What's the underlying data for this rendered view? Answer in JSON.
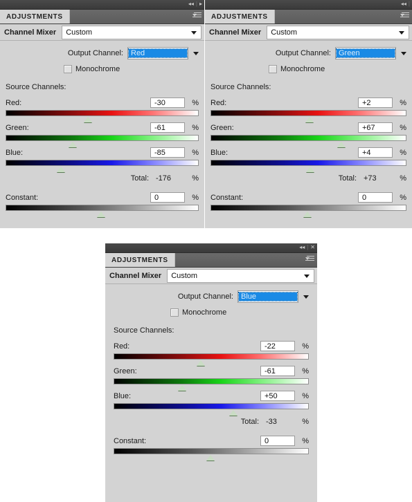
{
  "panels": [
    {
      "id": "panel-red",
      "titlebar": {
        "collapse_icon": "◂◂",
        "separator": "|",
        "expand_icon": "▸"
      },
      "tab_label": "ADJUSTMENTS",
      "menu_icon": "panel-menu-icon",
      "preset_label": "Channel Mixer",
      "preset_value": "Custom",
      "output_channel_label": "Output Channel:",
      "output_channel_value": "Red",
      "monochrome_label": "Monochrome",
      "monochrome_checked": false,
      "source_channels_label": "Source Channels:",
      "channels": [
        {
          "name": "Red:",
          "value": "-30",
          "unit": "%",
          "slider_pos": 42.5,
          "tint": "red"
        },
        {
          "name": "Green:",
          "value": "-61",
          "unit": "%",
          "slider_pos": 34.7,
          "tint": "green"
        },
        {
          "name": "Blue:",
          "value": "-85",
          "unit": "%",
          "slider_pos": 28.7,
          "tint": "blue"
        }
      ],
      "total_label": "Total:",
      "total_value": "-176",
      "total_unit": "%",
      "constant_label": "Constant:",
      "constant_value": "0",
      "constant_unit": "%",
      "constant_pos": 49.5
    },
    {
      "id": "panel-green",
      "titlebar": {
        "collapse_icon": "◂◂",
        "separator": "|",
        "expand_icon": ""
      },
      "tab_label": "ADJUSTMENTS",
      "menu_icon": "panel-menu-icon",
      "preset_label": "Channel Mixer",
      "preset_value": "Custom",
      "output_channel_label": "Output Channel:",
      "output_channel_value": "Green",
      "monochrome_label": "Monochrome",
      "monochrome_checked": false,
      "source_channels_label": "Source Channels:",
      "channels": [
        {
          "name": "Red:",
          "value": "+2",
          "unit": "%",
          "slider_pos": 50.5,
          "tint": "red"
        },
        {
          "name": "Green:",
          "value": "+67",
          "unit": "%",
          "slider_pos": 67.0,
          "tint": "green"
        },
        {
          "name": "Blue:",
          "value": "+4",
          "unit": "%",
          "slider_pos": 51.0,
          "tint": "blue"
        }
      ],
      "total_label": "Total:",
      "total_value": "+73",
      "total_unit": "%",
      "constant_label": "Constant:",
      "constant_value": "0",
      "constant_unit": "%",
      "constant_pos": 49.5
    },
    {
      "id": "panel-blue",
      "titlebar": {
        "collapse_icon": "◂◂",
        "separator": "|",
        "expand_icon": "✕"
      },
      "tab_label": "ADJUSTMENTS",
      "menu_icon": "panel-menu-icon",
      "preset_label": "Channel Mixer",
      "preset_value": "Custom",
      "output_channel_label": "Output Channel:",
      "output_channel_value": "Blue",
      "monochrome_label": "Monochrome",
      "monochrome_checked": false,
      "source_channels_label": "Source Channels:",
      "channels": [
        {
          "name": "Red:",
          "value": "-22",
          "unit": "%",
          "slider_pos": 44.5,
          "tint": "red"
        },
        {
          "name": "Green:",
          "value": "-61",
          "unit": "%",
          "slider_pos": 35.0,
          "tint": "green"
        },
        {
          "name": "Blue:",
          "value": "+50",
          "unit": "%",
          "slider_pos": 61.5,
          "tint": "blue"
        }
      ],
      "total_label": "Total:",
      "total_value": "-33",
      "total_unit": "%",
      "constant_label": "Constant:",
      "constant_value": "0",
      "constant_unit": "%",
      "constant_pos": 49.5
    }
  ],
  "colors": {
    "panel_background": "#d3d3d3",
    "selection_blue": "#1a8ae5",
    "titlebar_dark": "#3a3a3a",
    "tab_active": "#d6d6d6"
  }
}
